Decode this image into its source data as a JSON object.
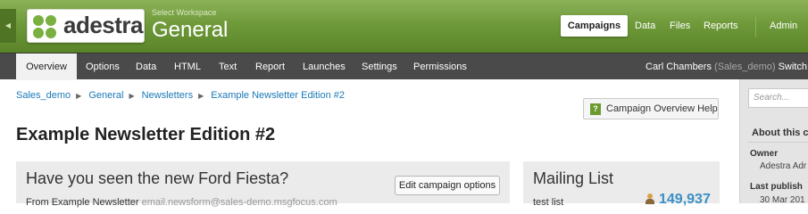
{
  "header": {
    "logo_text": "adestra",
    "workspace_label": "Select Workspace",
    "workspace_name": "General",
    "nav": {
      "campaigns": "Campaigns",
      "data": "Data",
      "files": "Files",
      "reports": "Reports",
      "admin": "Admin"
    },
    "collapse_glyph": "◀"
  },
  "subnav": {
    "tabs": [
      "Overview",
      "Options",
      "Data",
      "HTML",
      "Text",
      "Report",
      "Launches",
      "Settings",
      "Permissions"
    ],
    "active_tab": "Overview",
    "user_name": "Carl Chambers",
    "user_role": "(Sales_demo)",
    "switch_label": "Switch"
  },
  "breadcrumb": [
    "Sales_demo",
    "General",
    "Newsletters",
    "Example Newsletter Edition #2"
  ],
  "help_button": "Campaign Overview Help",
  "page_title": "Example Newsletter Edition #2",
  "campaign_panel": {
    "heading": "Have you seen the new Ford Fiesta?",
    "edit_button": "Edit campaign options",
    "from_name": "From Example Newsletter",
    "from_email": "email.newsform@sales-demo.msgfocus.com"
  },
  "mailing_panel": {
    "heading": "Mailing List",
    "list_name": "test list",
    "count": "149,937"
  },
  "sidebar": {
    "search_placeholder": "Search...",
    "about_heading": "About this c",
    "owner_label": "Owner",
    "owner_value": "Adestra Adr",
    "last_published_label": "Last publish",
    "last_published_value": "30 Mar 201"
  },
  "colors": {
    "brand_green": "#6f9a3a",
    "nav_dark": "#4a4a4a",
    "link_blue": "#1a7ab8",
    "count_blue": "#3a8fc6"
  }
}
